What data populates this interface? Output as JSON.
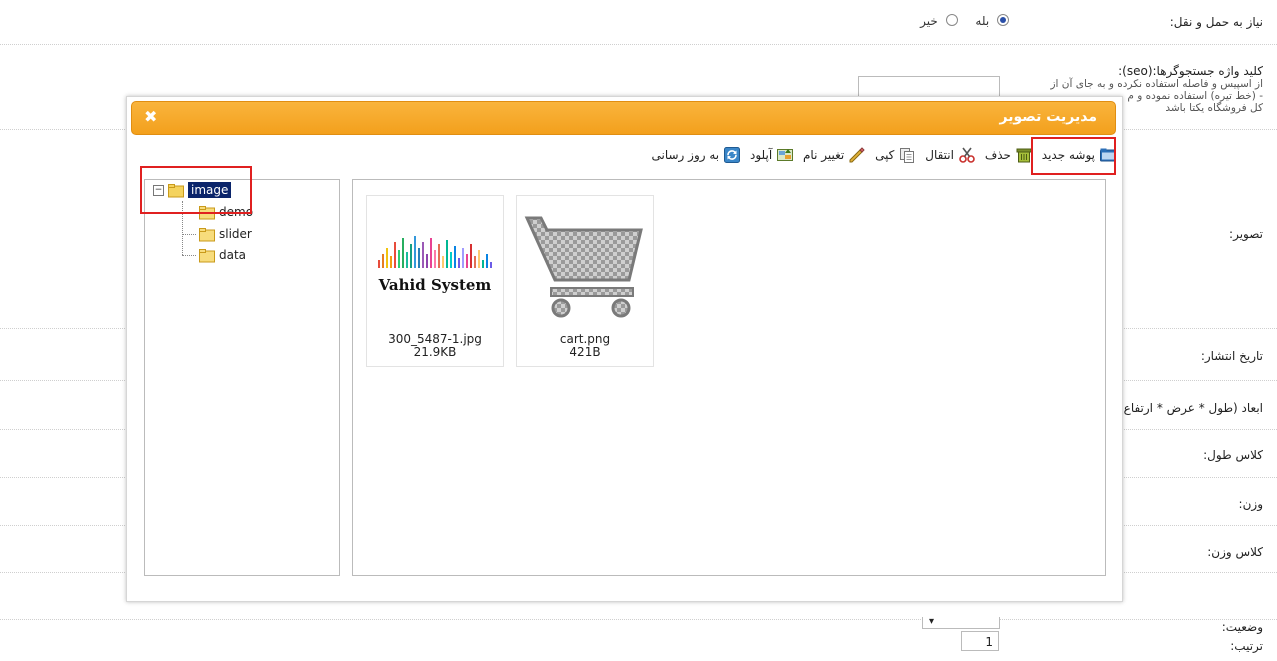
{
  "form": {
    "shipping_label": "نیاز به حمل و نقل:",
    "radio_yes": "بله",
    "radio_no": "خیر",
    "seo_label": "کلید واژه جستجوگرها:(seo):",
    "seo_help_1": "از اسپیس و فاصله استفاده نکرده و به جای آن از",
    "seo_help_2": "- (خط تیره) استفاده نموده و م",
    "seo_help_3": "کل فروشگاه یکتا باشد",
    "image_label": "تصویر:",
    "publish_date_label": "تاریخ انتشار:",
    "dimensions_label": "ابعاد (طول * عرض * ارتفاع",
    "length_class_label": "کلاس طول:",
    "weight_label": "وزن:",
    "weight_class_label": "کلاس وزن:",
    "status_label": "وضعیت:",
    "order_label": "ترتیب:",
    "order_value": "1"
  },
  "dialog": {
    "title": "مدیریت تصویر",
    "close_symbol": "✖",
    "toolbar": {
      "new_folder": "پوشه جدید",
      "delete": "حذف",
      "move": "انتقال",
      "copy": "کپی",
      "rename": "تغییر نام",
      "upload": "آپلود",
      "refresh": "به روز رسانی"
    },
    "tree": {
      "expander": "−",
      "root": "image",
      "children": [
        "demo",
        "slider",
        "data"
      ]
    },
    "files": [
      {
        "name": "300_5487-1.jpg",
        "size": "21.9KB",
        "thumb_text": "Vahid System"
      },
      {
        "name": "cart.png",
        "size": "421B"
      }
    ]
  },
  "colors": {
    "titlebar": "#f3a01c",
    "highlight": "#e02020",
    "tree_selected": "#0a246a"
  }
}
